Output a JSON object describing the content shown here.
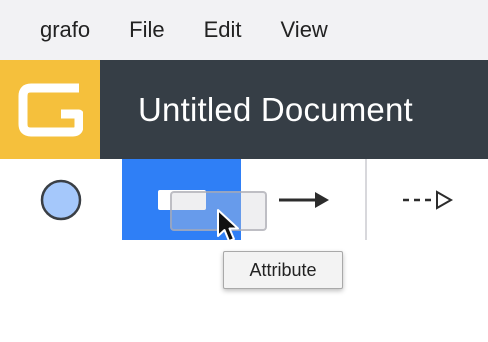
{
  "menubar": {
    "app_name": "grafo",
    "items": [
      {
        "label": "File"
      },
      {
        "label": "Edit"
      },
      {
        "label": "View"
      }
    ]
  },
  "header": {
    "logo_icon": "grafo-logo-icon",
    "document_title": "Untitled Document",
    "logo_color": "#f5c03c",
    "background_color": "#363e46"
  },
  "toolbar": {
    "tools": [
      {
        "name": "circle-tool",
        "icon": "circle-icon",
        "selected": false
      },
      {
        "name": "entity-tool",
        "icon": "rectangle-icon",
        "selected": true
      },
      {
        "name": "relation-arrow-tool",
        "icon": "solid-arrow-icon",
        "selected": false
      },
      {
        "name": "dashed-arrow-tool",
        "icon": "dashed-arrow-icon",
        "selected": false
      }
    ],
    "selected_color": "#2f7ff6"
  },
  "tooltip": {
    "text": "Attribute"
  }
}
